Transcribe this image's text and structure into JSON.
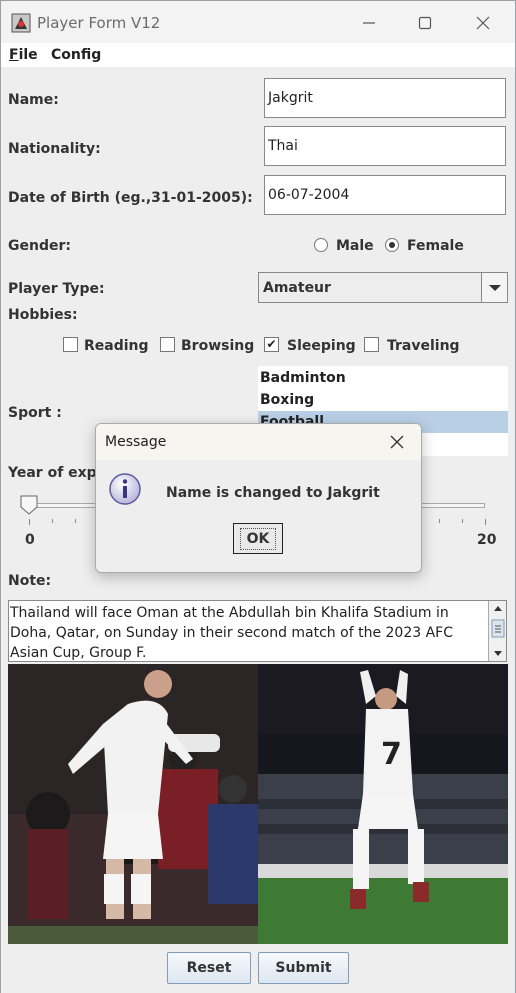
{
  "window": {
    "title": "Player Form V12",
    "icon": "player-card-icon"
  },
  "menu": {
    "file": "File",
    "config": "Config"
  },
  "form": {
    "name_label": "Name:",
    "name_value": "Jakgrit",
    "nationality_label": "Nationality:",
    "nationality_value": "Thai",
    "dob_label": "Date of Birth (eg.,31-01-2005):",
    "dob_value": "06-07-2004",
    "gender_label": "Gender:",
    "gender_options": [
      "Male",
      "Female"
    ],
    "gender_selected": "Female",
    "player_type_label": "Player Type:",
    "player_type_value": "Amateur",
    "hobbies_label": "Hobbies:",
    "hobbies": [
      {
        "label": "Reading",
        "checked": false
      },
      {
        "label": "Browsing",
        "checked": false
      },
      {
        "label": "Sleeping",
        "checked": true
      },
      {
        "label": "Traveling",
        "checked": false
      }
    ],
    "sport_label": "Sport :",
    "sports": [
      "Badminton",
      "Boxing",
      "Football"
    ],
    "sport_selected": "Football",
    "experience_label": "Year of expe",
    "slider_min": "0",
    "slider_max": "20",
    "slider_value": 0,
    "note_label": "Note:",
    "note_text": "Thailand will face Oman at the Abdullah bin Khalifa Stadium in Doha, Qatar, on Sunday in their second match of the 2023 AFC Asian Cup, Group F.",
    "reset_label": "Reset",
    "submit_label": "Submit"
  },
  "dialog": {
    "title": "Message",
    "message": "Name is changed to Jakgrit",
    "ok_label": "OK",
    "icon": "info-icon"
  },
  "colors": {
    "selection": "#b8cfe5",
    "window_bg": "#eeeeee",
    "button_border": "#7f9db9"
  }
}
